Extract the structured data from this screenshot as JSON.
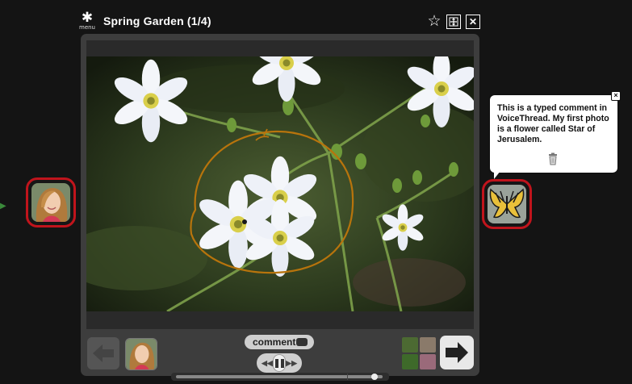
{
  "header": {
    "menu_icon": "gear-icon",
    "menu_label": "menu",
    "title": "Spring Garden (1/4)",
    "icons": [
      "star-icon",
      "fullscreen-icon",
      "close-icon"
    ]
  },
  "slide": {
    "image_subject": "flower-photo",
    "annotation_color": "#b8740c"
  },
  "comment": {
    "text": "This is a typed comment in VoiceThread. My first photo is a flower called Star of Jerusalem.",
    "close_icon": "close-icon",
    "delete_icon": "trash-icon"
  },
  "commenters": {
    "left_avatar": "woman-avatar",
    "right_avatar": "butterfly-avatar",
    "ring_color": "#c0141c"
  },
  "controls": {
    "comment_label": "comment",
    "prev_icon": "left-arrow-icon",
    "next_icon": "right-arrow-icon",
    "rewind_icon": "rewind-icon",
    "pause_icon": "pause-icon",
    "forward_icon": "fast-forward-icon",
    "thumbnails_icon": "slides-grid-icon"
  }
}
